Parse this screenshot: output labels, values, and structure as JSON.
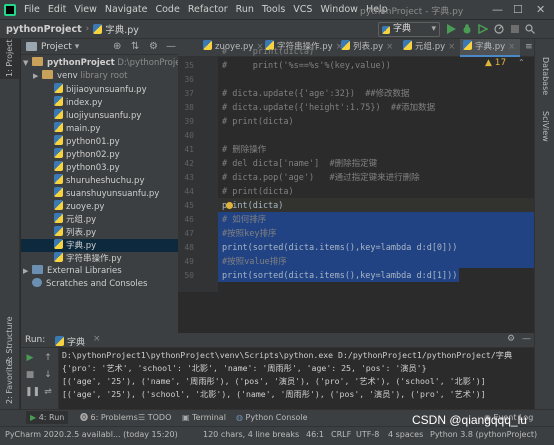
{
  "menubar": {
    "items": [
      "File",
      "Edit",
      "View",
      "Navigate",
      "Code",
      "Refactor",
      "Run",
      "Tools",
      "VCS",
      "Window",
      "Help"
    ],
    "window_title": "pythonProject - 字典.py",
    "min": "—",
    "max": "☐",
    "close": "✕"
  },
  "navbar": {
    "project": "pythonProject",
    "file": "字典.py",
    "run_config": "字典"
  },
  "project_panel": {
    "title": "Project",
    "root": {
      "name": "pythonProject",
      "path": "D:\\pythonProject1"
    },
    "items": [
      {
        "label": "venv",
        "note": "library root",
        "type": "folder"
      },
      {
        "label": "bijiaoyunsuanfu.py",
        "type": "py"
      },
      {
        "label": "index.py",
        "type": "py"
      },
      {
        "label": "luojiyunsuanfu.py",
        "type": "py"
      },
      {
        "label": "main.py",
        "type": "py"
      },
      {
        "label": "python01.py",
        "type": "py"
      },
      {
        "label": "python02.py",
        "type": "py"
      },
      {
        "label": "python03.py",
        "type": "py"
      },
      {
        "label": "shuruheshuchu.py",
        "type": "py"
      },
      {
        "label": "suanshuyunsuanfu.py",
        "type": "py"
      },
      {
        "label": "zuoye.py",
        "type": "py"
      },
      {
        "label": "元组.py",
        "type": "py"
      },
      {
        "label": "列表.py",
        "type": "py"
      },
      {
        "label": "字典.py",
        "type": "py"
      },
      {
        "label": "字符串操作.py",
        "type": "py"
      }
    ],
    "external": "External Libraries",
    "scratches": "Scratches and Consoles"
  },
  "tabs": [
    "zuoye.py",
    "字符串操作.py",
    "列表.py",
    "元组.py",
    "字典.py"
  ],
  "editor": {
    "warnings": "▲ 17",
    "lines": [
      {
        "n": "35",
        "text": "#     print('%s==%s'%(key,value))",
        "cls": "cm"
      },
      {
        "n": "36",
        "text": "",
        "cls": ""
      },
      {
        "n": "37",
        "text": "# dicta.update({'age':32})  ##修改数据",
        "cls": "cm"
      },
      {
        "n": "38",
        "text": "# dicta.update({'height':1.75})  ##添加数据",
        "cls": "cm"
      },
      {
        "n": "39",
        "text": "# print(dicta)",
        "cls": "cm"
      },
      {
        "n": "40",
        "text": "",
        "cls": ""
      },
      {
        "n": "41",
        "text": "# 删除操作",
        "cls": "cm"
      },
      {
        "n": "42",
        "text": "# del dicta['name']  #删除指定键",
        "cls": "cm"
      },
      {
        "n": "43",
        "text": "# dicta.pop('age')   #通过指定键来进行删除",
        "cls": "cm"
      },
      {
        "n": "44",
        "text": "# print(dicta)",
        "cls": "cm"
      },
      {
        "n": "45",
        "text": "print(dicta)",
        "cls": "fn"
      },
      {
        "n": "46",
        "text": "# 如何排序",
        "cls": "cm"
      },
      {
        "n": "47",
        "text": "#按照key排序",
        "cls": "cm"
      },
      {
        "n": "48",
        "text": "print(sorted(dicta.items(),key=lambda d:d[0]))",
        "cls": "fn"
      },
      {
        "n": "49",
        "text": "#按照value排序",
        "cls": "cm"
      },
      {
        "n": "50",
        "text": "print(sorted(dicta.items(),key=lambda d:d[1]))",
        "cls": "fn"
      }
    ],
    "top_partial": "print(dicta)"
  },
  "run": {
    "label": "Run:",
    "config": "字典",
    "output": [
      "D:\\pythonProject1\\pythonProject\\venv\\Scripts\\python.exe D:/pythonProject1/pythonProject/字典",
      "{'pro': '艺术', 'school': '北影', 'name': '周雨彤', 'age': 25, 'pos': '演员'}",
      "[('age', '25'), ('name', '周雨彤'), ('pos', '演员'), ('pro', '艺术'), ('school', '北影')]",
      "[('age', '25'), ('school', '北影'), ('name', '周雨彤'), ('pos', '演员'), ('pro', '艺术')]"
    ]
  },
  "bottom_tabs": [
    "4: Run",
    "6: Problems",
    "TODO",
    "Terminal",
    "Python Console",
    "Event Log"
  ],
  "side_tabs": {
    "left": [
      "1: Project",
      "7: Structure",
      "2: Favorites"
    ],
    "right": [
      "Database",
      "SciView"
    ]
  },
  "status": {
    "message": "PyCharm 2020.2.5 availabl... (today 15:20)",
    "selection": "120 chars, 4 line breaks",
    "position": "46:1",
    "line_sep": "CRLF",
    "encoding": "UTF-8",
    "indent": "4 spaces",
    "interpreter": "Python 3.8 (pythonProject)"
  },
  "watermark": "CSDN @qiangqqq_lu",
  "colors": {
    "accent": "#4a88c7",
    "selection": "#214283",
    "run_green": "#499c54"
  }
}
